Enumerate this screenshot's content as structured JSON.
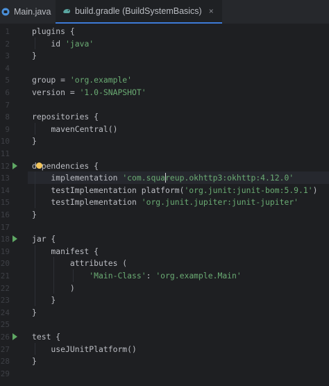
{
  "tabs": [
    {
      "label": "Main.java",
      "active": false,
      "icon": "java-file-icon"
    },
    {
      "label": "build.gradle (BuildSystemBasics)",
      "active": true,
      "icon": "gradle-file-icon",
      "close": "×"
    }
  ],
  "line_numbers": [
    "1",
    "2",
    "3",
    "4",
    "5",
    "6",
    "7",
    "8",
    "9",
    "10",
    "11",
    "12",
    "13",
    "14",
    "15",
    "16",
    "17",
    "18",
    "19",
    "20",
    "21",
    "22",
    "23",
    "24",
    "25",
    "26",
    "27",
    "28",
    "29"
  ],
  "code": [
    [
      "plugins {"
    ],
    [
      "    id ",
      "'java'"
    ],
    [
      "}"
    ],
    [
      ""
    ],
    [
      "group = ",
      "'org.example'"
    ],
    [
      "version = ",
      "'1.0-SNAPSHOT'"
    ],
    [
      ""
    ],
    [
      "repositories {"
    ],
    [
      "    mavenCentral()"
    ],
    [
      "}"
    ],
    [
      ""
    ],
    [
      "dependencies {"
    ],
    [
      "    implementation ",
      "'com.squareup.okhttp3:okhttp:4.12.0'"
    ],
    [
      "    testImplementation platform(",
      "'org.junit:junit-bom:5.9.1'",
      ")"
    ],
    [
      "    testImplementation ",
      "'org.junit.jupiter:junit-jupiter'"
    ],
    [
      "}"
    ],
    [
      ""
    ],
    [
      "jar {"
    ],
    [
      "    manifest {"
    ],
    [
      "        attributes ("
    ],
    [
      "            ",
      "'Main-Class'",
      ": ",
      "'org.example.Main'"
    ],
    [
      "        )"
    ],
    [
      "    }"
    ],
    [
      "}"
    ],
    [
      ""
    ],
    [
      "test {"
    ],
    [
      "    useJUnitPlatform()"
    ],
    [
      "}"
    ],
    [
      ""
    ]
  ],
  "colors": {
    "background": "#1e1f22",
    "string": "#6aab73",
    "text": "#bcbec4",
    "run_icon": "#5fa864",
    "active_tab_underline": "#3d7bd8"
  }
}
